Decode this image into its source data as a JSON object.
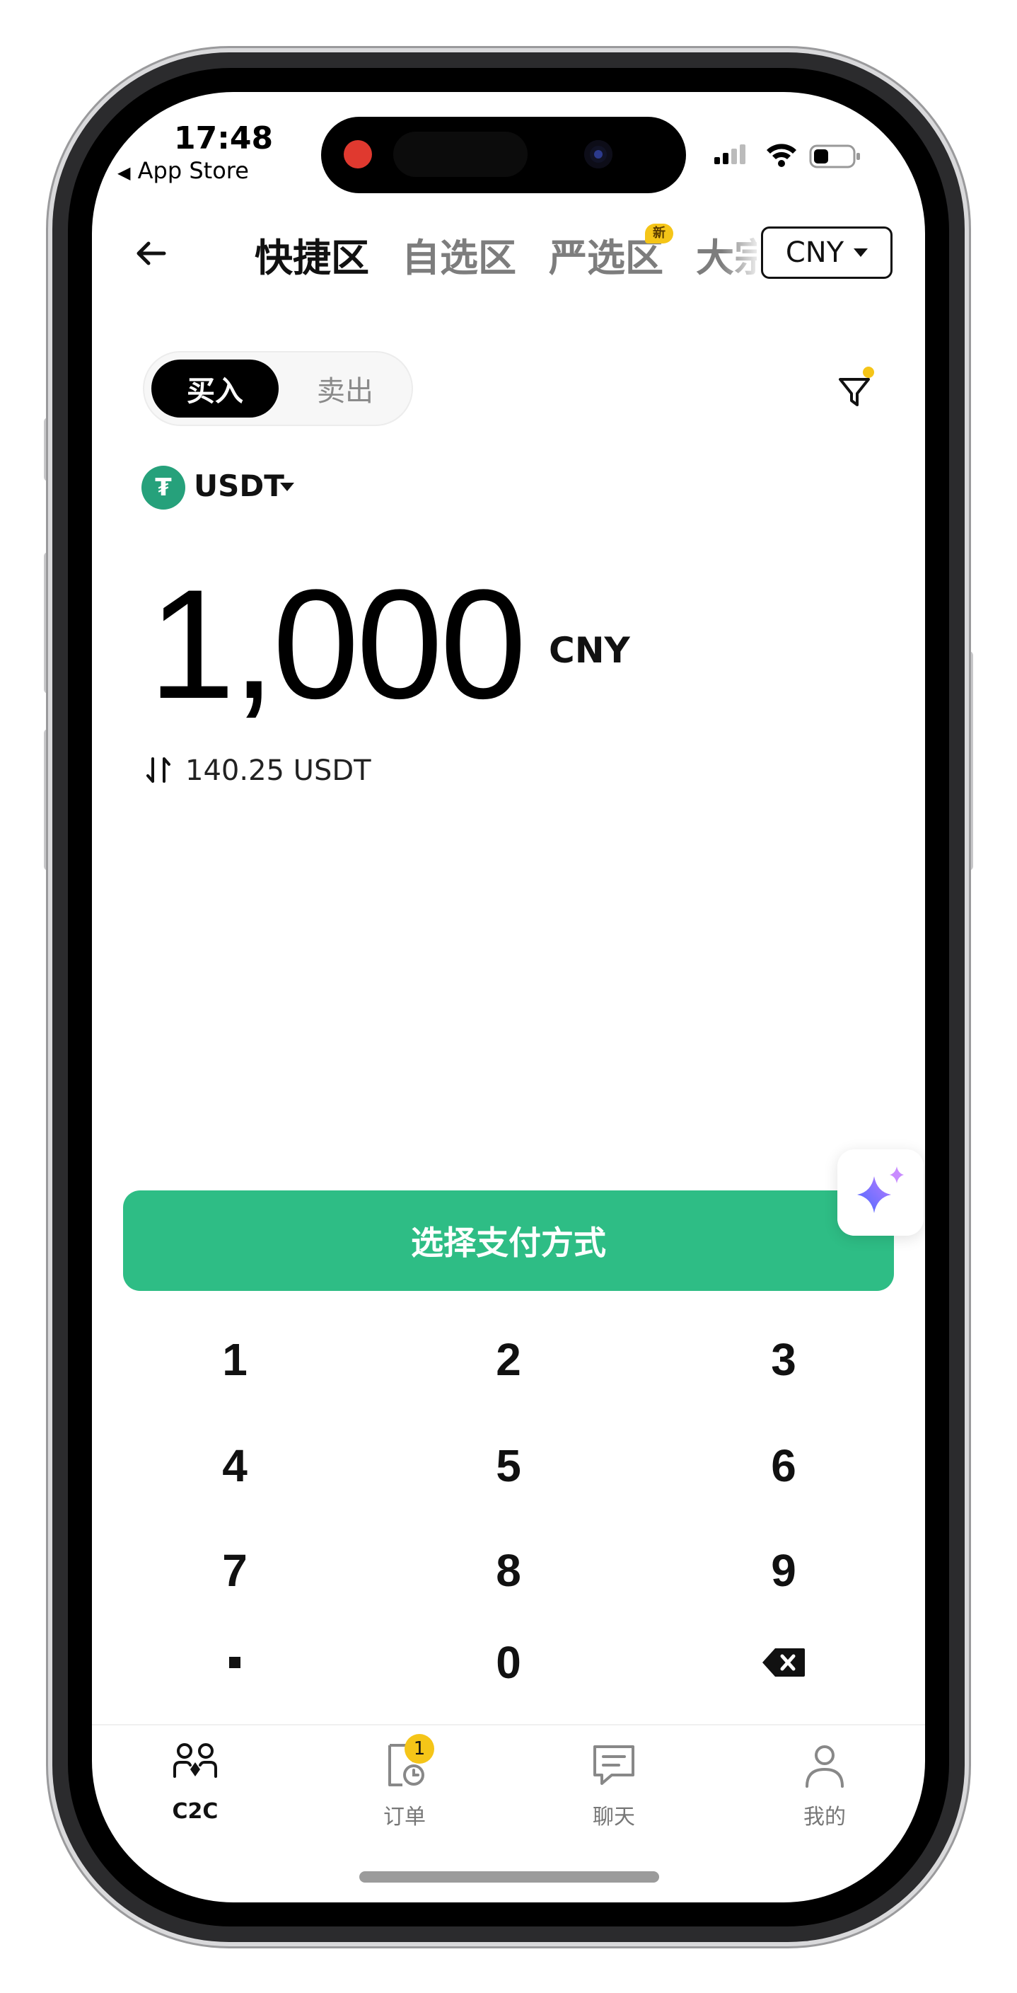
{
  "status_bar": {
    "time": "17:48",
    "back_label": "App Store"
  },
  "header": {
    "tabs": [
      {
        "label": "快捷区",
        "active": true
      },
      {
        "label": "自选区",
        "active": false
      },
      {
        "label": "严选区",
        "active": false,
        "badge": "新"
      },
      {
        "label": "大宗区",
        "active": false
      }
    ],
    "currency": "CNY"
  },
  "trade_toggle": {
    "buy_label": "买入",
    "sell_label": "卖出",
    "selected": "买入"
  },
  "coin": {
    "icon_symbol": "₮",
    "name": "USDT"
  },
  "amount": {
    "value": "1,000",
    "currency": "CNY",
    "converted": "140.25 USDT"
  },
  "cta": {
    "label": "选择支付方式"
  },
  "keypad": {
    "keys": [
      "1",
      "2",
      "3",
      "4",
      "5",
      "6",
      "7",
      "8",
      "9",
      ".",
      "0",
      "backspace"
    ]
  },
  "bottom_nav": {
    "items": [
      {
        "label": "C2C",
        "icon": "c2c-users-icon",
        "active": true
      },
      {
        "label": "订单",
        "icon": "order-icon",
        "active": false,
        "badge": "1"
      },
      {
        "label": "聊天",
        "icon": "chat-icon",
        "active": false
      },
      {
        "label": "我的",
        "icon": "profile-icon",
        "active": false
      }
    ]
  },
  "colors": {
    "accent": "#2ebd85",
    "badge": "#f5c518",
    "coin": "#26a17b"
  }
}
